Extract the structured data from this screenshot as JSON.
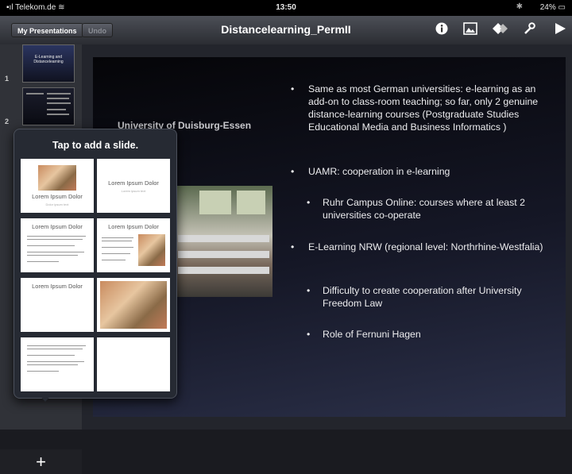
{
  "status": {
    "carrier": "Telekom.de",
    "time": "13:50",
    "battery": "24%"
  },
  "toolbar": {
    "my_presentations": "My Presentations",
    "undo": "Undo",
    "title": "Distancelearning_PermII"
  },
  "navigator": {
    "slides": [
      {
        "number": "1",
        "title": "E-Learning and Distancelearning"
      },
      {
        "number": "2"
      }
    ]
  },
  "popover": {
    "title": "Tap to add a slide.",
    "layouts": [
      {
        "label": "Lorem Ipsum Dolor",
        "sub": "Dolor ipsum text"
      },
      {
        "label": "Lorem Ipsum Dolor",
        "sub": "Lorem ipsum text"
      },
      {
        "label": "Lorem Ipsum Dolor"
      },
      {
        "label": "Lorem Ipsum Dolor"
      },
      {
        "label": "Lorem Ipsum Dolor"
      }
    ]
  },
  "slide": {
    "university": "University of Duisburg-Essen",
    "bullets": [
      {
        "level": 1,
        "text": "Same as most German universities: e-learning as an add-on to class-room teaching; so far, only 2 genuine distance-learning courses (Postgraduate Studies Educational Media and Business Informatics )"
      },
      {
        "level": 1,
        "text": "UAMR: cooperation in e-learning"
      },
      {
        "level": 2,
        "text": "Ruhr Campus Online: courses where at least 2 universities co-operate"
      },
      {
        "level": 1,
        "text": "E-Learning NRW  (regional level: Northrhine-Westfalia)"
      },
      {
        "level": 2,
        "text": "Difficulty to create cooperation after University Freedom Law"
      },
      {
        "level": 2,
        "text": "Role of Fernuni Hagen"
      }
    ]
  }
}
